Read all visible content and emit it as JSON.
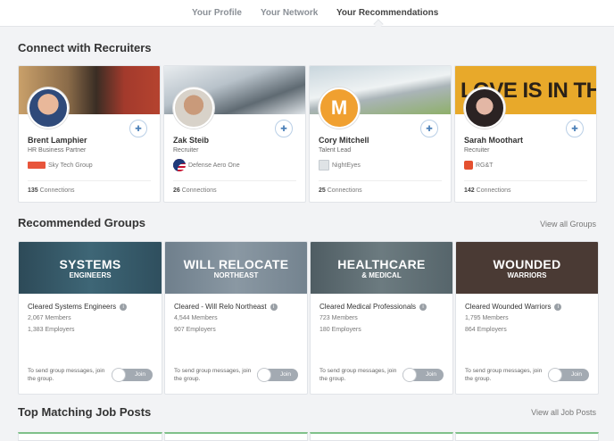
{
  "tabs": [
    {
      "label": "Your Profile"
    },
    {
      "label": "Your Network"
    },
    {
      "label": "Your Recommendations"
    }
  ],
  "recruiters_section": {
    "title": "Connect with Recruiters"
  },
  "recruiters": [
    {
      "name": "Brent Lamphier",
      "title": "HR Business Partner",
      "company": "Sky Tech Group",
      "connections": "135",
      "connections_label": "Connections",
      "add_icon": "add-user-icon"
    },
    {
      "name": "Zak Steib",
      "title": "Recruiter",
      "company": "Defense Aero One",
      "connections": "26",
      "connections_label": "Connections",
      "add_icon": "add-user-icon"
    },
    {
      "name": "Cory Mitchell",
      "title": "Talent Lead",
      "company": "NightEyes",
      "connections": "25",
      "connections_label": "Connections",
      "avatar_letter": "M",
      "add_icon": "add-user-icon"
    },
    {
      "name": "Sarah Moothart",
      "title": "Recruiter",
      "company": "RG&T",
      "connections": "142",
      "connections_label": "Connections",
      "add_icon": "add-user-icon",
      "banner_text": "LOVE IS IN THE"
    }
  ],
  "groups_section": {
    "title": "Recommended Groups",
    "view_all": "View all Groups"
  },
  "groups": [
    {
      "banner_line1": "SYSTEMS",
      "banner_line2": "ENGINEERS",
      "name": "Cleared Systems Engineers",
      "members": "2,067 Members",
      "employers": "1,383 Employers",
      "message": "To send group messages, join the group.",
      "join_label": "Join"
    },
    {
      "banner_line1": "WILL RELOCATE",
      "banner_line2": "NORTHEAST",
      "name": "Cleared - Will Relo Northeast",
      "members": "4,544 Members",
      "employers": "907 Employers",
      "message": "To send group messages, join the group.",
      "join_label": "Join"
    },
    {
      "banner_line1": "HEALTHCARE",
      "banner_line2": "& MEDICAL",
      "name": "Cleared Medical Professionals",
      "members": "723 Members",
      "employers": "180 Employers",
      "message": "To send group messages, join the group.",
      "join_label": "Join"
    },
    {
      "banner_line1": "WOUNDED",
      "banner_line2": "WARRIORS",
      "name": "Cleared Wounded Warriors",
      "members": "1,795 Members",
      "employers": "864 Employers",
      "message": "To send group messages, join the group.",
      "join_label": "Join"
    }
  ],
  "jobs_section": {
    "title": "Top Matching Job Posts",
    "view_all": "View all Job Posts"
  },
  "colors": {
    "accent": "#4a7fb8",
    "toggle": "#a3aab2",
    "job_strip": "#7fc18a"
  }
}
